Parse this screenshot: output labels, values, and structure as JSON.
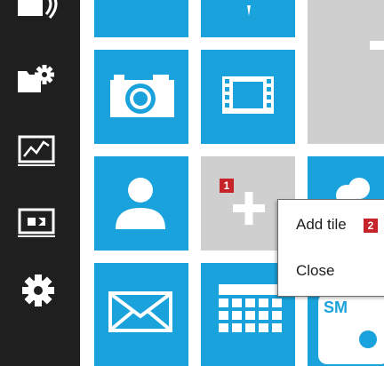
{
  "sidebar": {
    "icons": [
      "network-folder-icon",
      "folder-settings-icon",
      "performance-chart-icon",
      "presentation-icon",
      "settings-gear-icon"
    ]
  },
  "tiles": {
    "icons": [
      "camera-icon",
      "video-film-icon",
      "add-tile-placeholder",
      "contact-person-icon",
      "mail-icon",
      "calendar-icon",
      "skydrive-cloud-icon"
    ]
  },
  "badges": {
    "first": "1",
    "second": "2"
  },
  "context_menu": {
    "add_tile_label": "Add tile",
    "close_label": "Close"
  },
  "colors": {
    "tile_blue": "#1aa2dc",
    "placeholder_gray": "#cfcfcf",
    "badge_red": "#c62428",
    "sidebar_dark": "#1f1f1f"
  }
}
